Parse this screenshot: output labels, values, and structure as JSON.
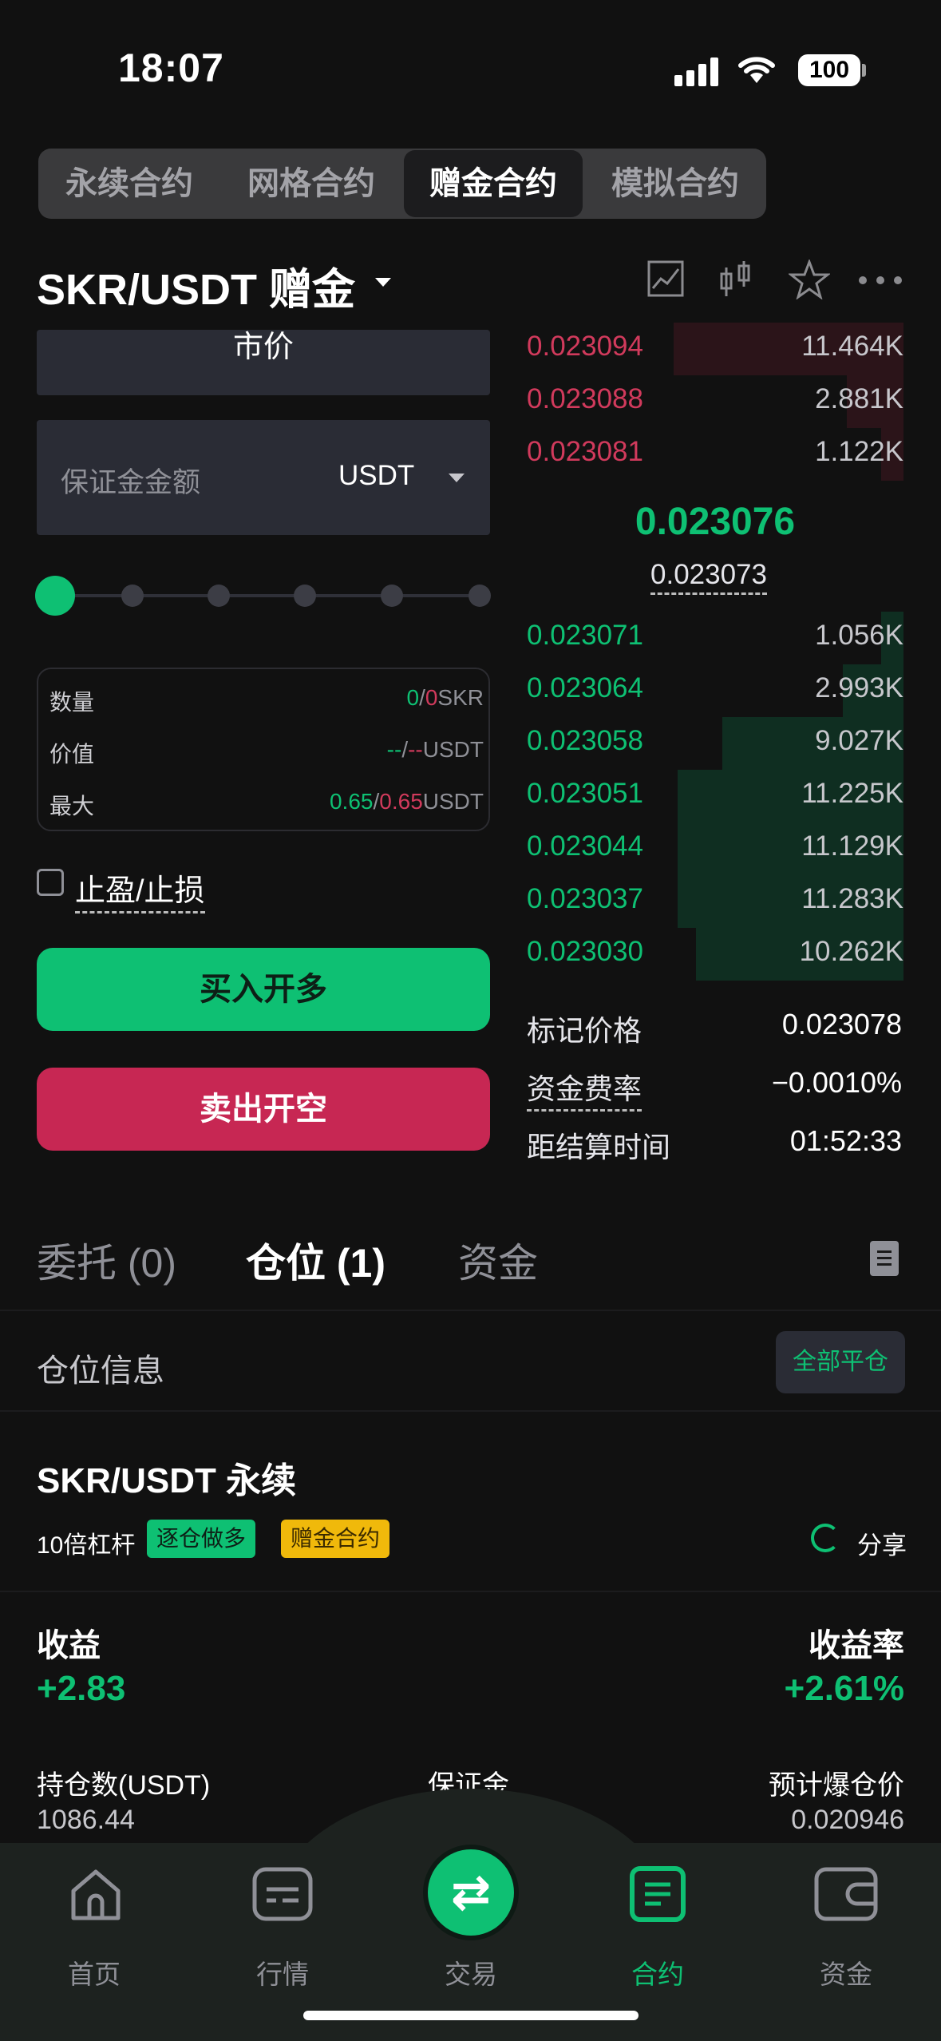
{
  "status": {
    "time": "18:07",
    "battery": "100"
  },
  "top_tabs": [
    "永续合约",
    "网格合约",
    "赠金合约",
    "模拟合约"
  ],
  "top_tabs_active": 2,
  "pair": {
    "name": "SKR/USDT 赠金"
  },
  "form": {
    "order_type": "市价",
    "margin_label": "保证金金额",
    "margin_unit": "USDT",
    "qty_label": "数量",
    "qty_a": "0",
    "qty_b": "0",
    "qty_unit": "SKR",
    "value_label": "价值",
    "value_a": "--",
    "value_b": "--",
    "value_unit": "USDT",
    "max_label": "最大",
    "max_a": "0.65",
    "max_b": "0.65",
    "max_unit": "USDT",
    "tpsl_label": "止盈/止损",
    "buy_label": "买入开多",
    "sell_label": "卖出开空",
    "slider_position": 0
  },
  "orderbook": {
    "asks": [
      {
        "price": "0.023094",
        "qty": "11.464K",
        "depth": 0.61
      },
      {
        "price": "0.023088",
        "qty": "2.881K",
        "depth": 0.15
      },
      {
        "price": "0.023081",
        "qty": "1.122K",
        "depth": 0.06
      }
    ],
    "mid_price": "0.023076",
    "mark_price": "0.023073",
    "bids": [
      {
        "price": "0.023071",
        "qty": "1.056K",
        "depth": 0.06
      },
      {
        "price": "0.023064",
        "qty": "2.993K",
        "depth": 0.16
      },
      {
        "price": "0.023058",
        "qty": "9.027K",
        "depth": 0.48
      },
      {
        "price": "0.023051",
        "qty": "11.225K",
        "depth": 0.6
      },
      {
        "price": "0.023044",
        "qty": "11.129K",
        "depth": 0.6
      },
      {
        "price": "0.023037",
        "qty": "11.283K",
        "depth": 0.6
      },
      {
        "price": "0.023030",
        "qty": "10.262K",
        "depth": 0.55
      }
    ]
  },
  "stats": [
    {
      "label": "标记价格",
      "value": "0.023078"
    },
    {
      "label": "资金费率",
      "value": "−0.0010%"
    },
    {
      "label": "距结算时间",
      "value": "01:52:33"
    }
  ],
  "bottom_tabs": {
    "orders": "委托 (0)",
    "positions": "仓位 (1)",
    "funds": "资金"
  },
  "position": {
    "section_title": "仓位信息",
    "close_all": "全部平仓",
    "title": "SKR/USDT 永续",
    "leverage": "10倍杠杆",
    "tag1": "逐仓做多",
    "tag2": "赠金合约",
    "share": "分享",
    "pnl_label": "收益",
    "pnl": "+2.83",
    "roe_label": "收益率",
    "roe": "+2.61%",
    "size_label": "持仓数(USDT)",
    "size": "1086.44",
    "margin_label": "保证金",
    "liq_label": "预计爆仓价",
    "liq": "0.020946"
  },
  "nav": [
    "首页",
    "行情",
    "交易",
    "合约",
    "资金"
  ],
  "nav_active": 3,
  "colors": {
    "green": "#0ec073",
    "red": "#d13a5c",
    "yellow": "#f0b90b"
  }
}
